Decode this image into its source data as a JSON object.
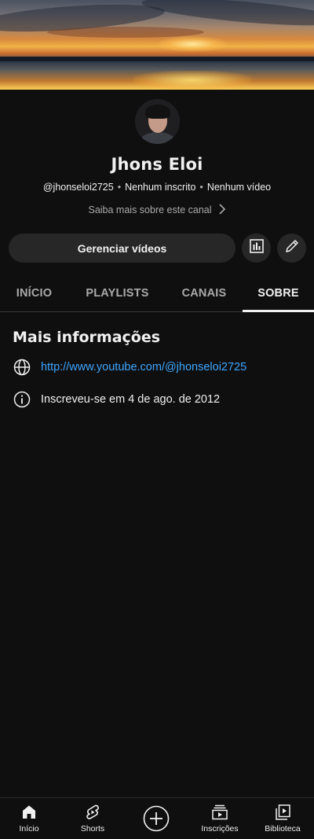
{
  "channel": {
    "name": "Jhons Eloi",
    "handle": "@jhonseloi2725",
    "subscribers": "Nenhum inscrito",
    "videos": "Nenhum vídeo",
    "about_link": "Saiba mais sobre este canal"
  },
  "actions": {
    "manage_videos": "Gerenciar vídeos"
  },
  "tabs": [
    {
      "label": "INÍCIO",
      "active": false
    },
    {
      "label": "PLAYLISTS",
      "active": false
    },
    {
      "label": "CANAIS",
      "active": false
    },
    {
      "label": "SOBRE",
      "active": true
    }
  ],
  "about": {
    "title": "Mais informações",
    "url": "http://www.youtube.com/@jhonseloi2725",
    "joined": "Inscreveu-se em 4 de ago. de 2012"
  },
  "bottom_nav": [
    {
      "label": "Início",
      "icon": "home-icon"
    },
    {
      "label": "Shorts",
      "icon": "shorts-icon"
    },
    {
      "label": "",
      "icon": "create-icon"
    },
    {
      "label": "Inscrições",
      "icon": "subscriptions-icon"
    },
    {
      "label": "Biblioteca",
      "icon": "library-icon"
    }
  ],
  "colors": {
    "background": "#0f0f0f",
    "button": "#272727",
    "link": "#3ea6ff",
    "secondary_text": "#aaaaaa"
  }
}
